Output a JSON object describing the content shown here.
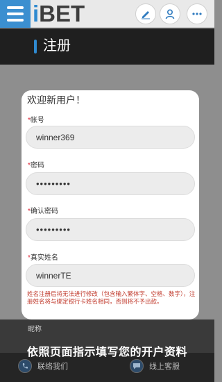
{
  "app": {
    "logo_i": "i",
    "logo_bet": "BET"
  },
  "header": {
    "icons": [
      "menu-icon",
      "edit-icon",
      "user-icon",
      "more-icon"
    ]
  },
  "page": {
    "title": "注册"
  },
  "form": {
    "welcome": "欢迎新用户！",
    "required_mark": "*",
    "fields": [
      {
        "label": "帐号",
        "value": "winner369"
      },
      {
        "label": "密码",
        "value": "•••••••••"
      },
      {
        "label": "确认密码",
        "value": "•••••••••"
      },
      {
        "label": "真实姓名",
        "value": "winnerTE"
      }
    ],
    "note": "姓名注册后将无法进行修改（包含输入繁体字、空格、数字），注册姓名将与绑定银行卡姓名相同，否则将不予出款。"
  },
  "footer": {
    "remark_label": "昵称",
    "caption": "依照页面指示填写您的开户资料",
    "contact_label": "联络我们",
    "service_label": "线上客服"
  },
  "colors": {
    "accent": "#2f8ad0",
    "warning": "#c0392b"
  }
}
